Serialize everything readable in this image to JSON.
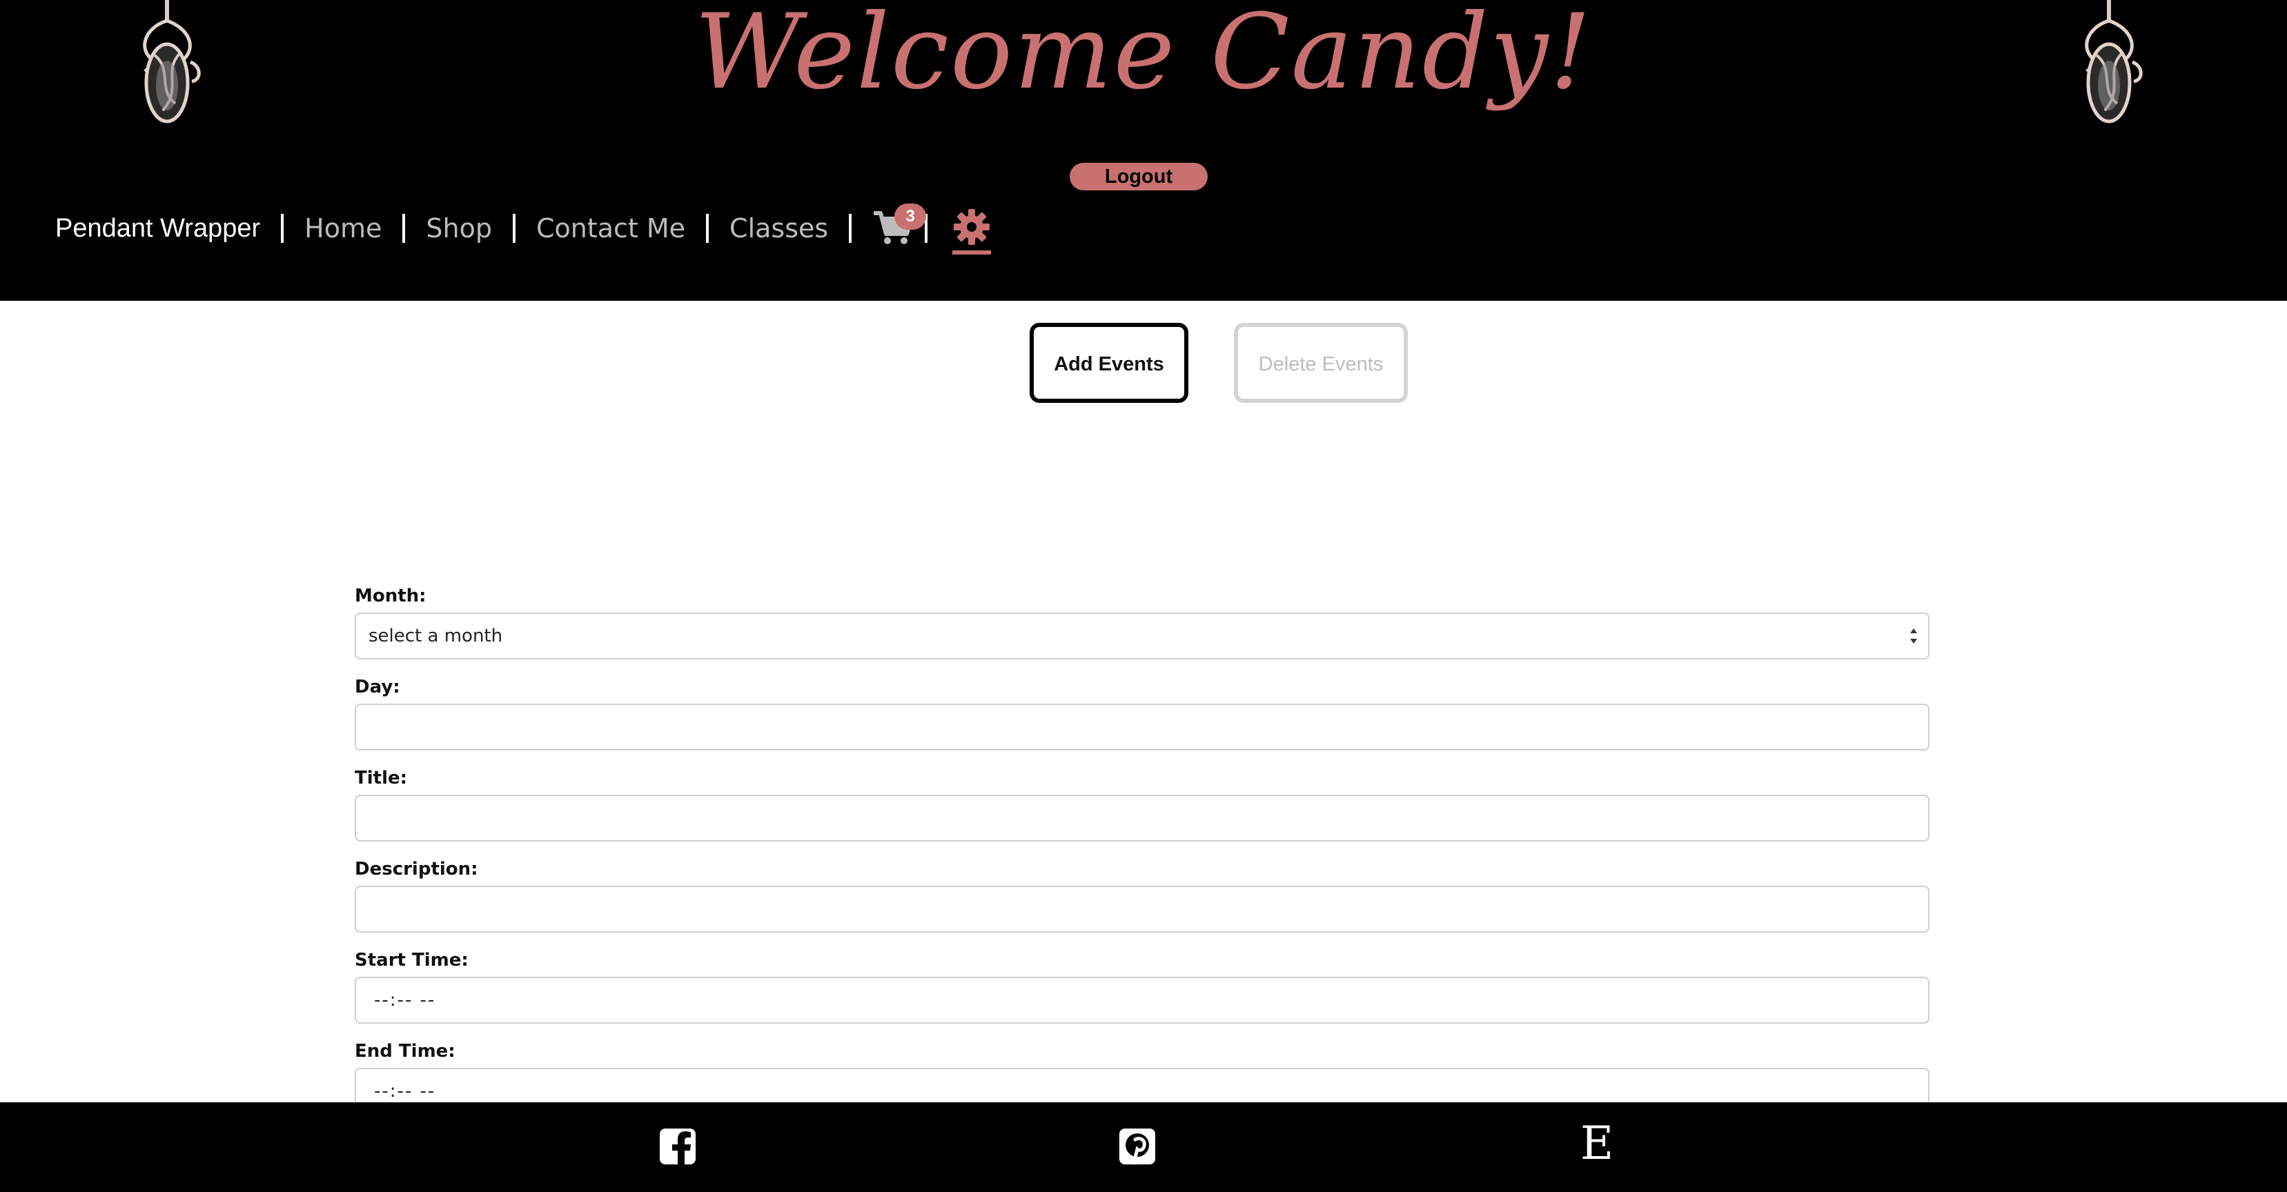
{
  "header": {
    "welcome": "Welcome Candy!",
    "logout_label": "Logout",
    "brand": "Pendant Wrapper",
    "nav": {
      "home": "Home",
      "shop": "Shop",
      "contact": "Contact Me",
      "classes": "Classes"
    },
    "cart_count": "3",
    "icons": {
      "cart": "shopping-cart-icon",
      "settings": "gear-icon",
      "decor": "wire-wrapped-pendant"
    }
  },
  "tabs": {
    "add": "Add Events",
    "delete": "Delete Events"
  },
  "form": {
    "month_label": "Month:",
    "month_value": "select a month",
    "day_label": "Day:",
    "day_value": "",
    "title_label": "Title:",
    "title_value": "",
    "description_label": "Description:",
    "description_value": "",
    "start_label": "Start Time:",
    "start_value": "--:-- --",
    "end_label": "End Time:",
    "end_value": "--:-- --"
  },
  "footer": {
    "icons": [
      "facebook-icon",
      "pinterest-icon",
      "etsy-icon"
    ],
    "etsy_glyph": "E"
  },
  "colors": {
    "accent": "#c97170",
    "header_bg": "#000000",
    "nav_link": "#bcbcbc",
    "field_border": "#cfcfcf"
  }
}
